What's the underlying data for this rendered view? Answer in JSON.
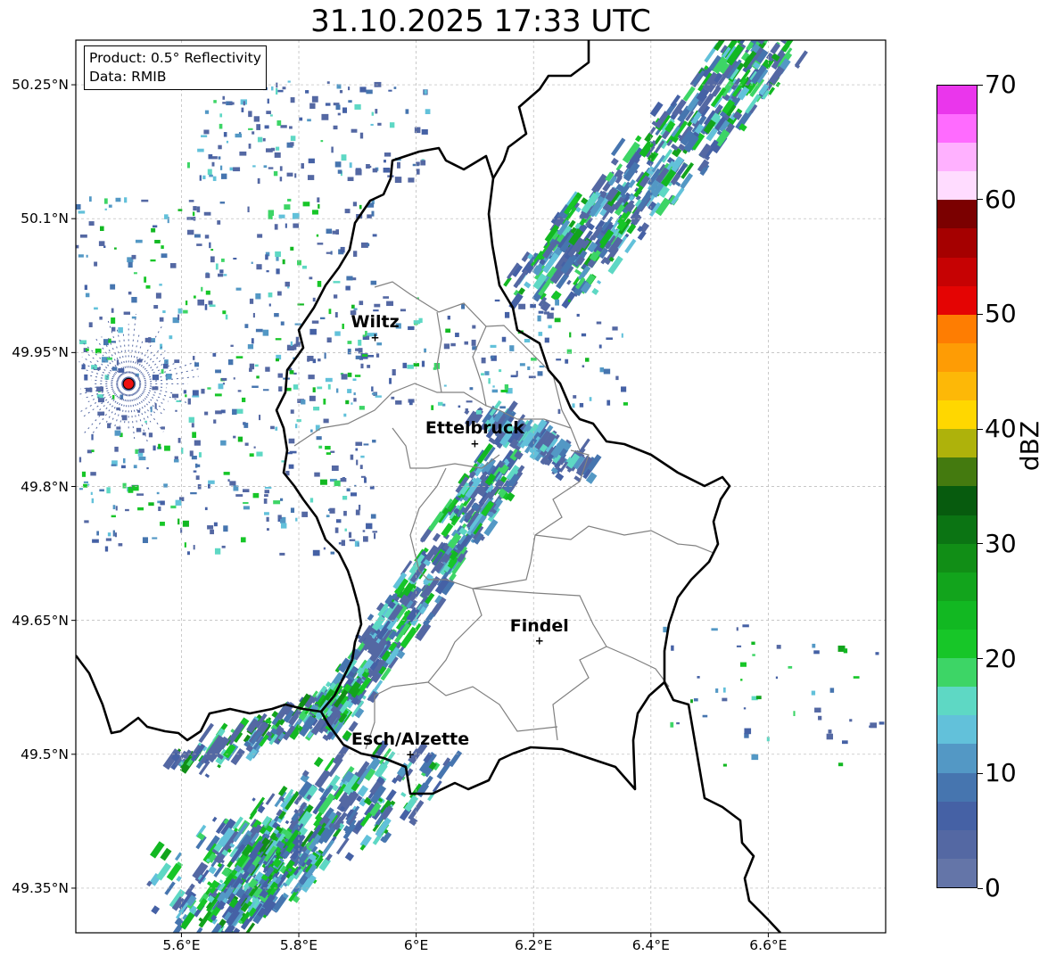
{
  "title": "31.10.2025 17:33 UTC",
  "info": {
    "product": "Product: 0.5° Reflectivity",
    "data": "Data: RMIB"
  },
  "map": {
    "lon_range": [
      5.42,
      6.8
    ],
    "lat_range": [
      49.3,
      50.3
    ],
    "x_ticks": [
      "5.6°E",
      "5.8°E",
      "6°E",
      "6.2°E",
      "6.4°E",
      "6.6°E"
    ],
    "x_tick_values": [
      5.6,
      5.8,
      6.0,
      6.2,
      6.4,
      6.6
    ],
    "y_ticks": [
      "50.25°N",
      "50.1°N",
      "49.95°N",
      "49.8°N",
      "49.65°N",
      "49.5°N",
      "49.35°N"
    ],
    "y_tick_values": [
      50.25,
      50.1,
      49.95,
      49.8,
      49.65,
      49.5,
      49.35
    ],
    "gridlines": true,
    "radar_site": {
      "lon": 5.51,
      "lat": 49.915,
      "color": "#ee1111"
    },
    "cities": [
      {
        "name": "Wiltz",
        "lon": 5.93,
        "lat": 49.967
      },
      {
        "name": "Ettelbruck",
        "lon": 6.1,
        "lat": 49.848
      },
      {
        "name": "Findel",
        "lon": 6.21,
        "lat": 49.627
      },
      {
        "name": "Esch/Alzette",
        "lon": 5.99,
        "lat": 49.5
      }
    ]
  },
  "colorbar": {
    "label": "dBZ",
    "min": 0,
    "max": 70,
    "tick_labels": [
      "0",
      "10",
      "20",
      "30",
      "40",
      "50",
      "60",
      "70"
    ],
    "colors": [
      "#6475a8",
      "#5468a3",
      "#4561a5",
      "#4675af",
      "#5398c5",
      "#62c1da",
      "#5ed8c4",
      "#3dd566",
      "#17c628",
      "#12b822",
      "#12a41c",
      "#118e16",
      "#0b7413",
      "#075b0e",
      "#447a0f",
      "#aeb20b",
      "#ffd700",
      "#fdb807",
      "#fe9c05",
      "#fe7d02",
      "#e40403",
      "#c60203",
      "#a50000",
      "#7b0000",
      "#ffdcff",
      "#ffb1ff",
      "#ff6bff",
      "#ea36ec"
    ]
  }
}
